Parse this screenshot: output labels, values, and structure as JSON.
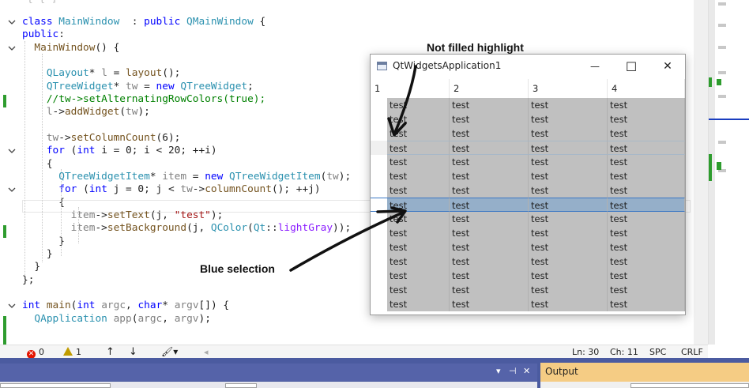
{
  "editor": {
    "lines": [
      {
        "fold": true,
        "tokens": [
          [
            "kw",
            "class "
          ],
          [
            "ty",
            "MainWindow"
          ],
          [
            "",
            "  : "
          ],
          [
            "kw",
            "public "
          ],
          [
            "ty",
            "QMainWindow"
          ],
          [
            "",
            " {"
          ]
        ]
      },
      {
        "fold": false,
        "tokens": [
          [
            "kw",
            "public"
          ],
          [
            "",
            ":"
          ]
        ]
      },
      {
        "fold": true,
        "tokens": [
          [
            "",
            "  "
          ],
          [
            "fn",
            "MainWindow"
          ],
          [
            "",
            "() {"
          ]
        ]
      },
      {
        "fold": false,
        "tokens": [
          [
            "",
            ""
          ]
        ]
      },
      {
        "fold": false,
        "tokens": [
          [
            "",
            "    "
          ],
          [
            "ty",
            "QLayout"
          ],
          [
            "",
            "* "
          ],
          [
            "pa",
            "l"
          ],
          [
            "",
            " = "
          ],
          [
            "fn",
            "layout"
          ],
          [
            "",
            "();"
          ]
        ]
      },
      {
        "fold": false,
        "tokens": [
          [
            "",
            "    "
          ],
          [
            "ty",
            "QTreeWidget"
          ],
          [
            "",
            "* "
          ],
          [
            "pa",
            "tw"
          ],
          [
            "",
            " = "
          ],
          [
            "kw",
            "new "
          ],
          [
            "ty",
            "QTreeWidget"
          ],
          [
            "",
            ";"
          ]
        ]
      },
      {
        "fold": false,
        "tokens": [
          [
            "",
            "    "
          ],
          [
            "cm",
            "//tw->setAlternatingRowColors(true);"
          ]
        ]
      },
      {
        "fold": false,
        "tokens": [
          [
            "",
            "    "
          ],
          [
            "pa",
            "l"
          ],
          [
            "",
            "->"
          ],
          [
            "fn",
            "addWidget"
          ],
          [
            "",
            "("
          ],
          [
            "pa",
            "tw"
          ],
          [
            "",
            ");"
          ]
        ]
      },
      {
        "fold": false,
        "tokens": [
          [
            "",
            ""
          ]
        ]
      },
      {
        "fold": false,
        "tokens": [
          [
            "",
            "    "
          ],
          [
            "pa",
            "tw"
          ],
          [
            "",
            "->"
          ],
          [
            "fn",
            "setColumnCount"
          ],
          [
            "",
            "(6);"
          ]
        ]
      },
      {
        "fold": true,
        "tokens": [
          [
            "",
            "    "
          ],
          [
            "kw",
            "for "
          ],
          [
            "",
            "("
          ],
          [
            "kw",
            "int "
          ],
          [
            "",
            "i = 0; i < 20; ++i)"
          ]
        ]
      },
      {
        "fold": false,
        "tokens": [
          [
            "",
            "    {"
          ]
        ]
      },
      {
        "fold": false,
        "tokens": [
          [
            "",
            "      "
          ],
          [
            "ty",
            "QTreeWidgetItem"
          ],
          [
            "",
            "* "
          ],
          [
            "pa",
            "item"
          ],
          [
            "",
            " = "
          ],
          [
            "kw",
            "new "
          ],
          [
            "ty",
            "QTreeWidgetItem"
          ],
          [
            "",
            "("
          ],
          [
            "pa",
            "tw"
          ],
          [
            "",
            ");"
          ]
        ]
      },
      {
        "fold": true,
        "tokens": [
          [
            "",
            "      "
          ],
          [
            "kw",
            "for "
          ],
          [
            "",
            "("
          ],
          [
            "kw",
            "int "
          ],
          [
            "",
            "j = 0; j < "
          ],
          [
            "pa",
            "tw"
          ],
          [
            "",
            "->"
          ],
          [
            "fn",
            "columnCount"
          ],
          [
            "",
            "(); ++j)"
          ]
        ]
      },
      {
        "fold": false,
        "tokens": [
          [
            "",
            "      {"
          ]
        ]
      },
      {
        "fold": false,
        "tokens": [
          [
            "",
            "        "
          ],
          [
            "pa",
            "item"
          ],
          [
            "",
            "->"
          ],
          [
            "fn",
            "setText"
          ],
          [
            "",
            "(j, "
          ],
          [
            "st",
            "\"test\""
          ],
          [
            "",
            ");"
          ]
        ]
      },
      {
        "fold": false,
        "tokens": [
          [
            "",
            "        "
          ],
          [
            "pa",
            "item"
          ],
          [
            "",
            "->"
          ],
          [
            "fn",
            "setBackground"
          ],
          [
            "",
            "(j, "
          ],
          [
            "ty",
            "QColor"
          ],
          [
            "",
            "("
          ],
          [
            "ty",
            "Qt"
          ],
          [
            "",
            "::"
          ],
          [
            "mb",
            "lightGray"
          ],
          [
            "",
            "));"
          ]
        ]
      },
      {
        "fold": false,
        "tokens": [
          [
            "",
            "      }"
          ]
        ]
      },
      {
        "fold": false,
        "tokens": [
          [
            "",
            "    }"
          ]
        ]
      },
      {
        "fold": false,
        "tokens": [
          [
            "",
            "  }"
          ]
        ]
      },
      {
        "fold": false,
        "tokens": [
          [
            "",
            "};"
          ]
        ]
      },
      {
        "fold": false,
        "tokens": [
          [
            "",
            ""
          ]
        ]
      },
      {
        "fold": true,
        "tokens": [
          [
            "kw",
            "int "
          ],
          [
            "fn",
            "main"
          ],
          [
            "",
            "("
          ],
          [
            "kw",
            "int "
          ],
          [
            "pa",
            "argc"
          ],
          [
            "",
            ", "
          ],
          [
            "kw",
            "char"
          ],
          [
            "",
            "* "
          ],
          [
            "pa",
            "argv"
          ],
          [
            "",
            "[]) {"
          ]
        ]
      },
      {
        "fold": false,
        "tokens": [
          [
            "",
            "  "
          ],
          [
            "ty",
            "QApplication"
          ],
          [
            "",
            " "
          ],
          [
            "pa",
            "app"
          ],
          [
            "",
            "("
          ],
          [
            "pa",
            "argc"
          ],
          [
            "",
            ", "
          ],
          [
            "pa",
            "argv"
          ],
          [
            "",
            ");"
          ]
        ]
      }
    ]
  },
  "statusbar": {
    "errors": "0",
    "warnings": "1",
    "line": "Ln: 30",
    "col": "Ch: 11",
    "spacing": "SPC",
    "eol": "CRLF"
  },
  "output_panel": {
    "title": "Output"
  },
  "qt_window": {
    "title": "QtWidgetsApplication1",
    "minimize": "—",
    "maximize": "☐",
    "close": "✕",
    "headers": [
      "1",
      "2",
      "3",
      "4"
    ],
    "cell_text": "test",
    "row_count": 15,
    "highlight_row": 3,
    "selected_row": 7,
    "cell_color": "#c0c0c0",
    "selection_color": "#95afc9"
  },
  "annotations": {
    "top": "Not filled highlight",
    "bottom": "Blue selection"
  },
  "colors": {
    "accent_blue": "#3c78c4",
    "dock_bg": "#4b5ba0",
    "output_tab": "#f5cc84",
    "change_bar": "#2e9c2e"
  }
}
